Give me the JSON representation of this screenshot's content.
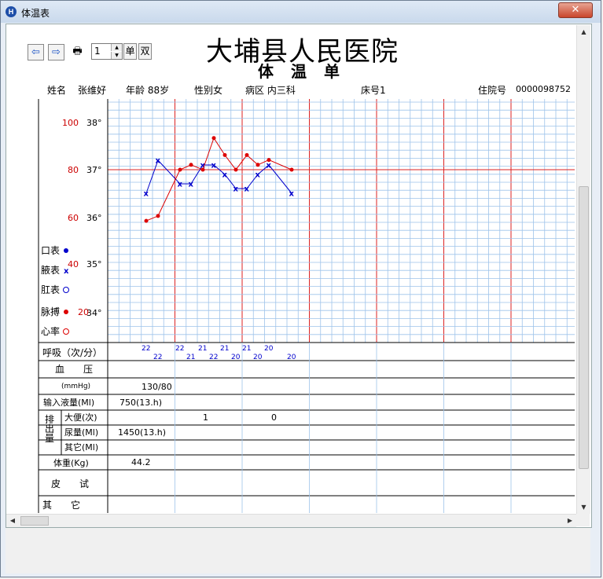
{
  "window": {
    "title": "体温表",
    "app_icon": "H",
    "close_label": "✕"
  },
  "toolbar": {
    "page_value": "1",
    "single_label": "单",
    "double_label": "双"
  },
  "header": {
    "hospital": "大埔县人民医院",
    "title": "体　温　单",
    "name_label": "姓名",
    "name_value": "张维好",
    "age": "年龄 88岁",
    "sex": "性别女",
    "ward": "病区 内三科",
    "bed": "床号1",
    "inpatient_label": "住院号",
    "inpatient_value": "0000098752"
  },
  "axes": {
    "pulse_ticks": [
      "100",
      "80",
      "60",
      "40",
      "20"
    ],
    "temp_ticks": [
      "38°",
      "37°",
      "36°",
      "35°",
      "34°"
    ]
  },
  "legend": {
    "oral": "口表",
    "axillary": "腋表",
    "rectal": "肛表",
    "pulse": "脉搏",
    "heart": "心率"
  },
  "chart_data": {
    "type": "line",
    "series": [
      {
        "name": "腋表",
        "color": "#0000cc",
        "values": [
          36.5,
          37.2,
          36.7,
          36.7,
          37.1,
          37.1,
          36.9,
          36.6,
          36.6,
          36.9,
          37.1,
          36.5
        ]
      },
      {
        "name": "脉搏",
        "color": "#dd0000",
        "values": [
          59,
          61,
          80,
          82,
          80,
          93,
          86,
          80,
          86,
          82,
          84,
          80
        ]
      }
    ]
  },
  "respiration": {
    "label": "呼吸（次/分）",
    "values": [
      "22",
      "22",
      "22",
      "21",
      "21",
      "22",
      "21",
      "20",
      "21",
      "20",
      "20",
      "20"
    ]
  },
  "rows": {
    "bp_label": "血　　压",
    "bp_unit": "(mmHg)",
    "bp_value": "130/80",
    "infusion_label": "输入液量(Ml)",
    "infusion_value": "750(13.h)",
    "output_label": "排出量",
    "stool_label": "大便(次)",
    "stool_values": [
      "1",
      "0"
    ],
    "urine_label": "尿量(Ml)",
    "urine_value": "1450(13.h)",
    "other_out_label": "其它(Ml)",
    "weight_label": "体重(Kg)",
    "weight_value": "44.2",
    "skin_test_label": "皮　　试",
    "other_label": "其　　它"
  }
}
